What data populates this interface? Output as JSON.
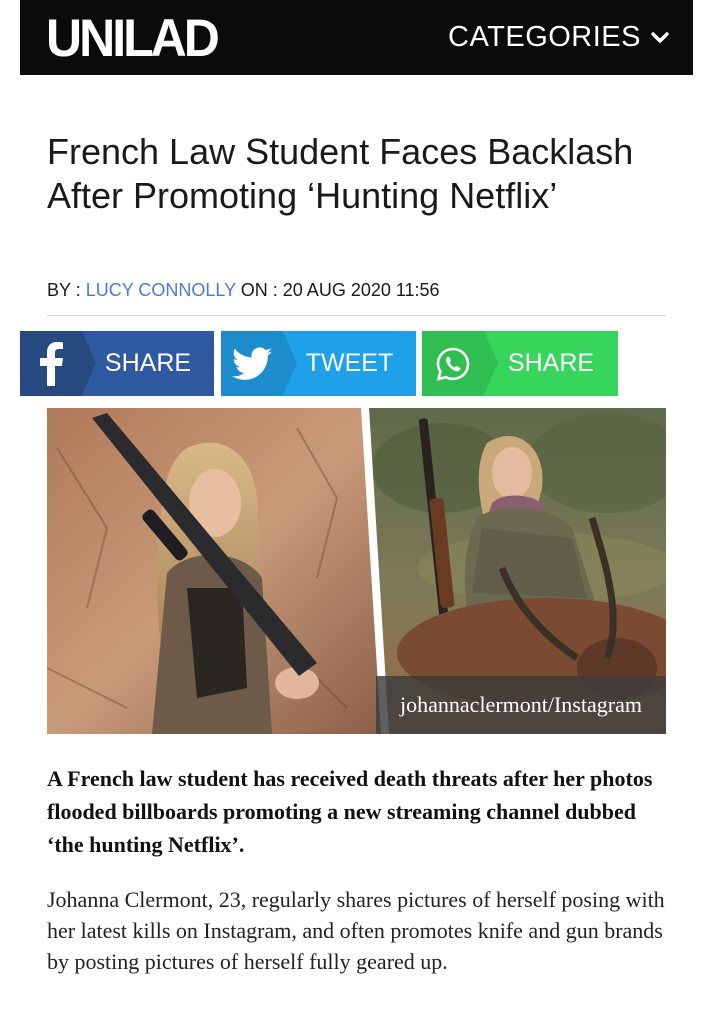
{
  "header": {
    "logo": "UNILAD",
    "categories_label": "CATEGORIES"
  },
  "article": {
    "headline": "French Law Student Faces Backlash After Promoting ‘Hunting Netflix’",
    "byline_prefix": "BY : ",
    "author": "LUCY CONNOLLY",
    "byline_on": " ON : ",
    "date": "20 AUG 2020 11:56",
    "image_credit": "johannaclermont/Instagram",
    "lead": "A French law student has received death threats after her photos flooded billboards promoting a new streaming channel dubbed ‘the hunting Netflix’.",
    "body": "Johanna Clermont, 23, regularly shares pictures of herself posing with her latest kills on Instagram, and often promotes knife and gun brands by posting pictures of herself fully geared up."
  },
  "share": {
    "facebook_label": "SHARE",
    "twitter_label": "TWEET",
    "whatsapp_label": "SHARE",
    "facebook_icon": "facebook-icon",
    "twitter_icon": "twitter-bird-icon",
    "whatsapp_icon": "whatsapp-icon"
  },
  "colors": {
    "header_bg": "#0b0b0b",
    "author_link": "#4a7bd0",
    "facebook": "#2f5aa1",
    "twitter": "#1ea1e8",
    "whatsapp": "#37d55c"
  }
}
